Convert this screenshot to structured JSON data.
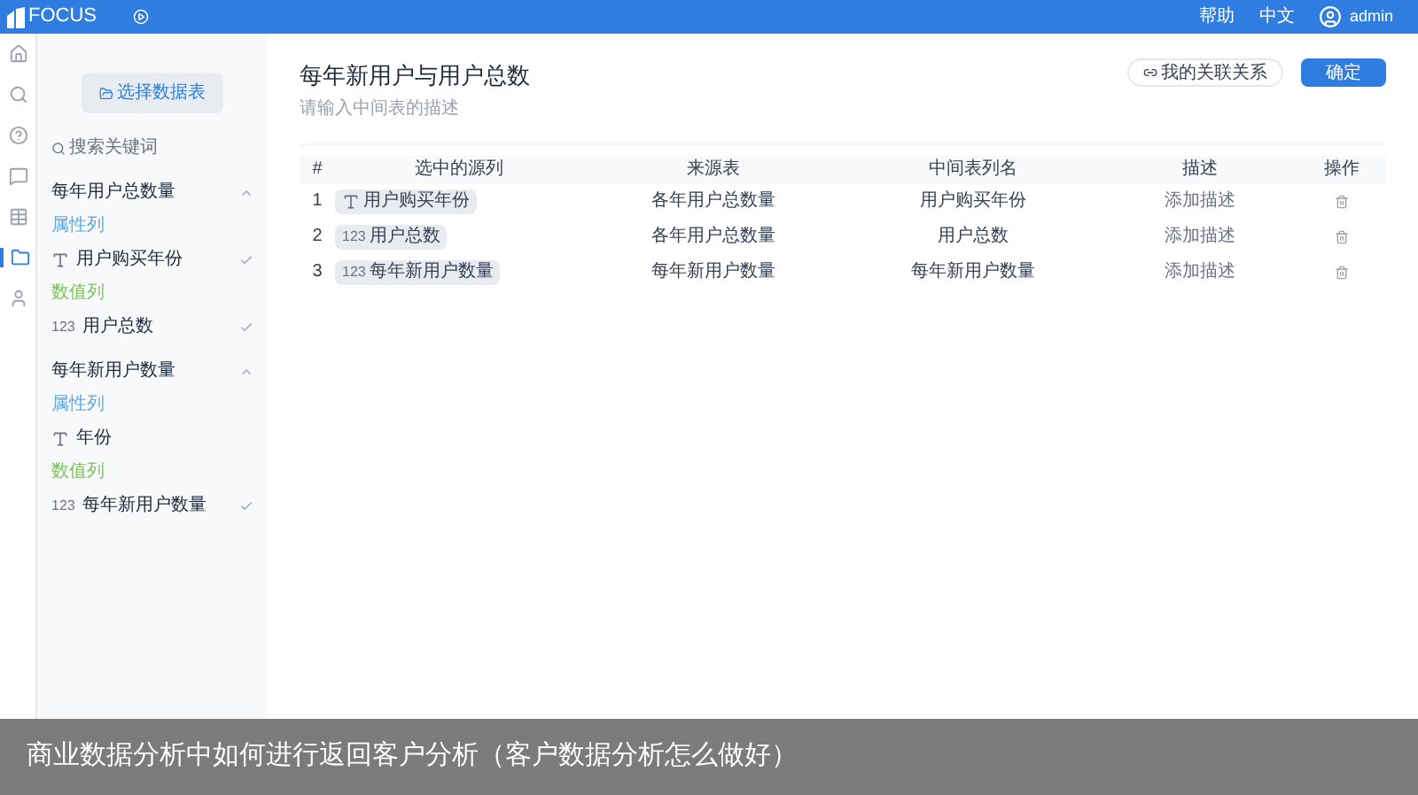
{
  "topbar": {
    "brand": "FOCUS",
    "links": [
      "帮助",
      "中文"
    ],
    "user": "admin"
  },
  "rail": [
    {
      "selected": false
    },
    {
      "selected": false
    },
    {
      "selected": false
    },
    {
      "selected": false
    },
    {
      "selected": false
    },
    {
      "selected": true
    },
    {
      "selected": false
    }
  ],
  "sidebar": {
    "button": "选择数据表",
    "search_placeholder": "搜索关键词",
    "groups": [
      {
        "title": "每年用户总数量",
        "expanded": true,
        "sections": [
          {
            "title": "属性列",
            "color": "#5aa9e6",
            "items": [
              {
                "kind": "text",
                "label": "用户购买年份",
                "checked": true
              }
            ]
          },
          {
            "title": "数值列",
            "color": "#7cc45a",
            "items": [
              {
                "kind": "number",
                "type_label": "123",
                "label": "用户总数",
                "checked": true
              }
            ]
          }
        ]
      },
      {
        "title": "每年新用户数量",
        "expanded": true,
        "sections": [
          {
            "title": "属性列",
            "color": "#5aa9e6",
            "items": [
              {
                "kind": "text",
                "label": "年份",
                "checked": false
              }
            ]
          },
          {
            "title": "数值列",
            "color": "#7cc45a",
            "items": [
              {
                "kind": "number",
                "type_label": "123",
                "label": "每年新用户数量",
                "checked": true
              }
            ]
          }
        ]
      }
    ]
  },
  "main": {
    "title": "每年新用户与用户总数",
    "description_placeholder": "请输入中间表的描述",
    "buttons": [
      {
        "kind": "outline",
        "label": "我的关联关系"
      },
      {
        "kind": "primary",
        "label": "确定"
      }
    ],
    "table": {
      "columns": [
        "#",
        "选中的源列",
        "来源表",
        "中间表列名",
        "描述",
        "操作"
      ],
      "rows": [
        {
          "index": "1",
          "source": {
            "kind": "text",
            "label": "用户购买年份"
          },
          "table": "各年用户总数量",
          "name": "用户购买年份",
          "description_placeholder": "添加描述"
        },
        {
          "index": "2",
          "source": {
            "kind": "number",
            "type_label": "123",
            "label": "用户总数"
          },
          "table": "各年用户总数量",
          "name": "用户总数",
          "description_placeholder": "添加描述"
        },
        {
          "index": "3",
          "source": {
            "kind": "number",
            "type_label": "123",
            "label": "每年新用户数量"
          },
          "table": "每年新用户数量",
          "name": "每年新用户数量",
          "description_placeholder": "添加描述"
        }
      ]
    }
  },
  "caption": "商业数据分析中如何进行返回客户分析（客户数据分析怎么做好）"
}
